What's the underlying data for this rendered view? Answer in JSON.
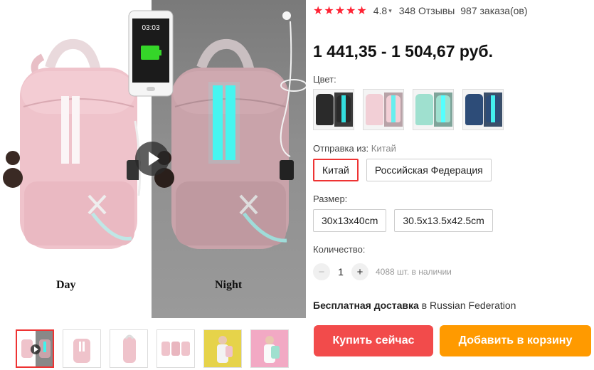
{
  "product": {
    "rating": "4.8",
    "reviews": "348 Отзывы",
    "orders": "987 заказа(ов)",
    "price": "1 441,35 - 1 504,67 руб."
  },
  "gallery": {
    "day_label": "Day",
    "night_label": "Night",
    "phone_time": "03:03"
  },
  "color": {
    "label": "Цвет:",
    "swatches": [
      {
        "left": "#2a2a2a",
        "right": "#3a3a3a",
        "glow": "#3dd"
      },
      {
        "left": "#f2cfd6",
        "right": "#b8a3a8",
        "glow": "#6ee"
      },
      {
        "left": "#9fe0cf",
        "right": "#7fa49a",
        "glow": "#5ff"
      },
      {
        "left": "#2d4c78",
        "right": "#3a4f6a",
        "glow": "#4ee"
      }
    ]
  },
  "ship_from": {
    "label": "Отправка из:",
    "selected": "Китай",
    "options": [
      "Китай",
      "Российская Федерация"
    ]
  },
  "size": {
    "label": "Размер:",
    "options": [
      "30x13x40cm",
      "30.5x13.5x42.5cm"
    ]
  },
  "quantity": {
    "label": "Количество:",
    "minus": "−",
    "value": "1",
    "plus": "+",
    "stock": "4088 шт. в наличии"
  },
  "shipping": {
    "bold": "Бесплатная доставка",
    "rest": "в Russian Federation"
  },
  "actions": {
    "buy": "Купить сейчас",
    "cart": "Добавить в корзину"
  },
  "colors": {
    "accent_red": "#f24b4b",
    "accent_orange": "#ff9a00",
    "star": "#ff2233"
  }
}
